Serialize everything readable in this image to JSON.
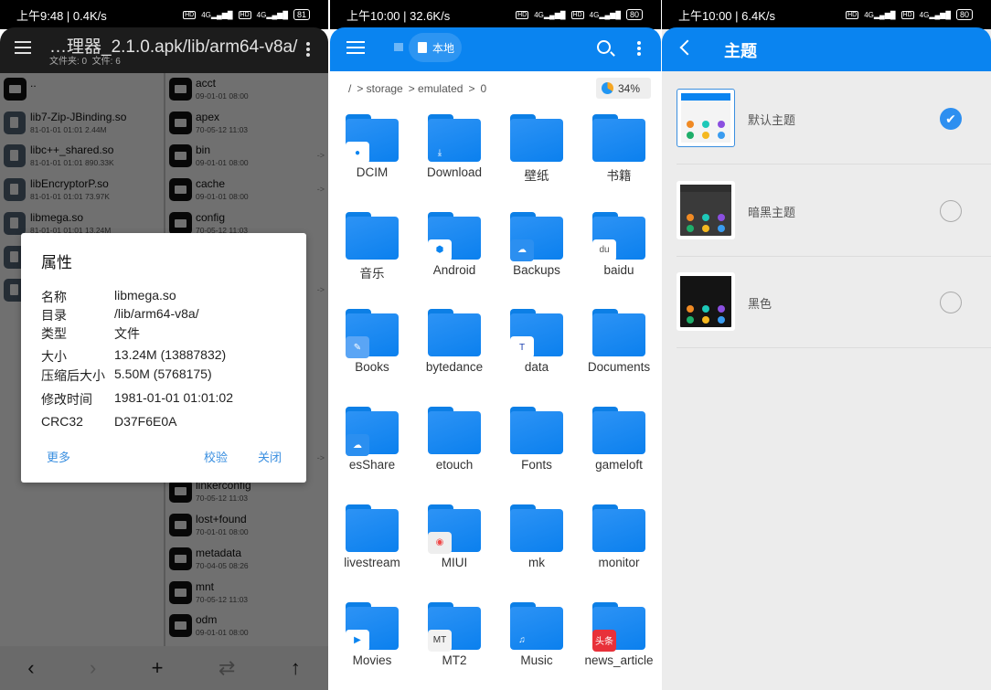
{
  "panel_left": {
    "status": {
      "time": "上午9:48 | 0.4K/s",
      "battery": "81"
    },
    "header": {
      "title": "…理器_2.1.0.apk/lib/arm64-v8a/",
      "subtitle": "文件夹: 0  文件: 6"
    },
    "left_list": [
      {
        "name": "..",
        "meta": "",
        "type": "folder"
      },
      {
        "name": "lib7-Zip-JBinding.so",
        "meta": "81-01-01 01:01  2.44M",
        "type": "file"
      },
      {
        "name": "libc++_shared.so",
        "meta": "81-01-01 01:01  890.33K",
        "type": "file"
      },
      {
        "name": "libEncryptorP.so",
        "meta": "81-01-01 01:01  73.97K",
        "type": "file"
      },
      {
        "name": "libmega.so",
        "meta": "81-01-01 01:01  13.24M",
        "type": "file"
      }
    ],
    "right_list": [
      {
        "name": "acct",
        "meta": "09-01-01 08:00"
      },
      {
        "name": "apex",
        "meta": "70-05-12 11:03"
      },
      {
        "name": "bin",
        "meta": "09-01-01 08:00",
        "link": "->"
      },
      {
        "name": "cache",
        "meta": "09-01-01 08:00",
        "link": "->"
      },
      {
        "name": "config",
        "meta": "70-05-12 11:03"
      },
      {
        "name": "linkerconfig",
        "meta": "70-05-12 11:03"
      },
      {
        "name": "lost+found",
        "meta": "70-01-01 08:00"
      },
      {
        "name": "metadata",
        "meta": "70-04-05 08:26"
      },
      {
        "name": "mnt",
        "meta": "70-05-12 11:03"
      },
      {
        "name": "odm",
        "meta": "09-01-01 08:00"
      }
    ],
    "link_marker": "->",
    "bottom_nav": {
      "back": "‹",
      "forward": "›",
      "add": "+",
      "swap": "⇄",
      "up": "↑"
    },
    "dialog": {
      "title": "属性",
      "props": [
        {
          "k": "名称",
          "v": "libmega.so"
        },
        {
          "k": "目录",
          "v": "/lib/arm64-v8a/"
        },
        {
          "k": "类型",
          "v": "文件"
        },
        {
          "k": "大小",
          "v": "13.24M (13887832)"
        },
        {
          "k": "压缩后大小",
          "v": "5.50M (5768175)"
        },
        {
          "k": "修改时间",
          "v": "1981-01-01 01:01:02"
        },
        {
          "k": "CRC32",
          "v": "D37F6E0A"
        }
      ],
      "more": "更多",
      "verify": "校验",
      "close": "关闭"
    }
  },
  "panel_middle": {
    "status": {
      "time": "上午10:00 | 32.6K/s",
      "battery": "80"
    },
    "header": {
      "chip": "本地"
    },
    "breadcrumb": [
      "/",
      "> storage",
      "> emulated",
      ">",
      "0"
    ],
    "usage": "34%",
    "usage_fraction": 0.34,
    "accent": "#0a84f0",
    "folders": [
      {
        "name": "DCIM",
        "badge": "camera"
      },
      {
        "name": "Download",
        "badge": "download"
      },
      {
        "name": "壁纸",
        "badge": ""
      },
      {
        "name": "书籍",
        "badge": ""
      },
      {
        "name": "音乐",
        "badge": ""
      },
      {
        "name": "Android",
        "badge": "android"
      },
      {
        "name": "Backups",
        "badge": "cloud"
      },
      {
        "name": "baidu",
        "badge": "du"
      },
      {
        "name": "Books",
        "badge": "books"
      },
      {
        "name": "bytedance",
        "badge": ""
      },
      {
        "name": "data",
        "badge": "t-app"
      },
      {
        "name": "Documents",
        "badge": ""
      },
      {
        "name": "esShare",
        "badge": "cloud"
      },
      {
        "name": "etouch",
        "badge": ""
      },
      {
        "name": "Fonts",
        "badge": ""
      },
      {
        "name": "gameloft",
        "badge": ""
      },
      {
        "name": "livestream",
        "badge": ""
      },
      {
        "name": "MIUI",
        "badge": "record"
      },
      {
        "name": "mk",
        "badge": ""
      },
      {
        "name": "monitor",
        "badge": ""
      },
      {
        "name": "Movies",
        "badge": "play"
      },
      {
        "name": "MT2",
        "badge": "mt"
      },
      {
        "name": "Music",
        "badge": "note"
      },
      {
        "name": "news_article",
        "badge": "头条"
      }
    ]
  },
  "panel_right": {
    "status": {
      "time": "上午10:00 | 6.4K/s",
      "battery": "80"
    },
    "header": {
      "title": "主题"
    },
    "themes": [
      {
        "label": "默认主题",
        "selected": true,
        "style": "light"
      },
      {
        "label": "暗黑主题",
        "selected": false,
        "style": "dark"
      },
      {
        "label": "黑色",
        "selected": false,
        "style": "black"
      }
    ]
  }
}
